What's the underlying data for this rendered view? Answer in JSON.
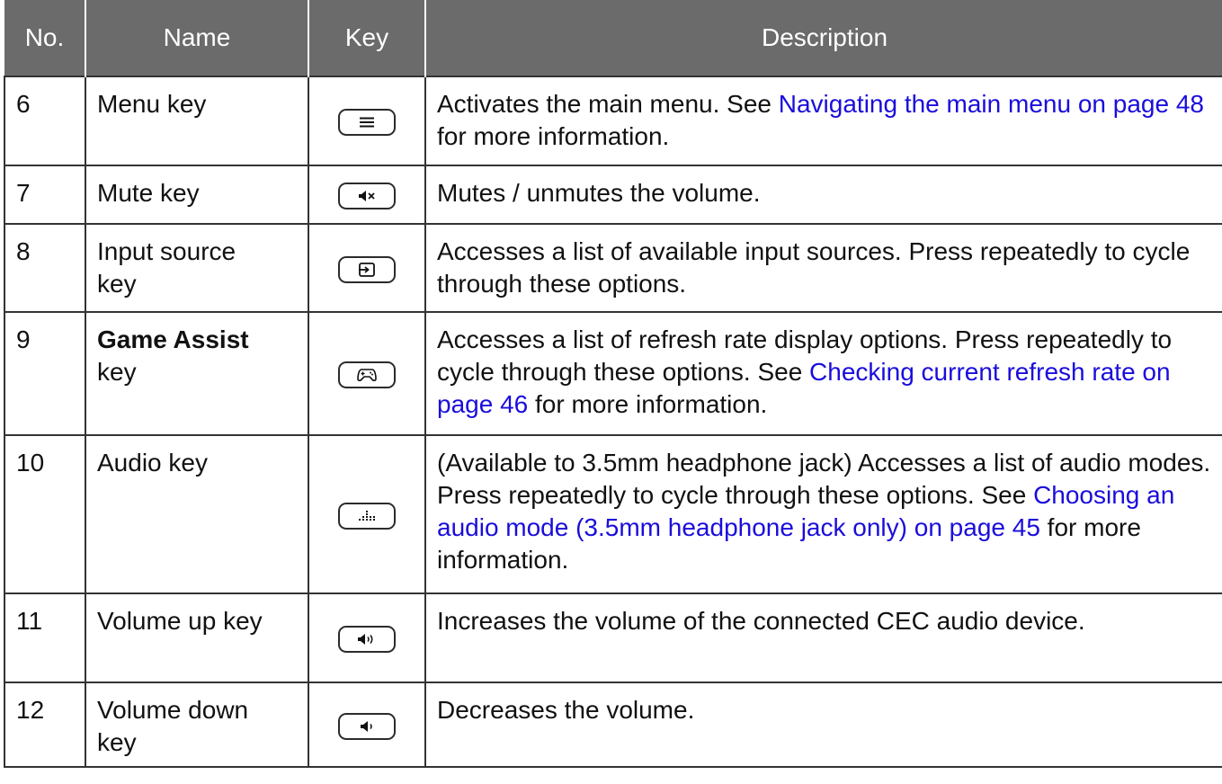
{
  "headers": {
    "no": "No.",
    "name": "Name",
    "key": "Key",
    "description": "Description"
  },
  "rows": [
    {
      "no": "6",
      "name_line1": "Menu key",
      "icon": "menu-icon",
      "desc_text1": "Activates the main menu. See ",
      "desc_link": "Navigating the main menu on page 48",
      "desc_text2": " for more information."
    },
    {
      "no": "7",
      "name_line1": "Mute key",
      "icon": "mute-icon",
      "desc_text1": "Mutes / unmutes the volume."
    },
    {
      "no": "8",
      "name_line1": "Input source",
      "name_line2": "key",
      "icon": "input-source-icon",
      "desc_text1": "Accesses a list of available input sources. Press repeatedly to cycle through these options."
    },
    {
      "no": "9",
      "name_bold": "Game Assist",
      "name_line2": "key",
      "icon": "gamepad-icon",
      "desc_text1": "Accesses a list of refresh rate display options. Press repeatedly to cycle through these options. See ",
      "desc_link": "Checking current refresh rate on page 46",
      "desc_text2": " for more information."
    },
    {
      "no": "10",
      "name_line1": "Audio key",
      "icon": "equalizer-icon",
      "desc_text1": "(Available to 3.5mm headphone jack) Accesses a list of audio modes. Press repeatedly to cycle through these options. See ",
      "desc_link": "Choosing an audio mode (3.5mm headphone jack only) on page 45",
      "desc_text2": " for more information."
    },
    {
      "no": "11",
      "name_line1": "Volume up key",
      "icon": "volume-up-icon",
      "desc_text1": "Increases the volume of the connected CEC audio device."
    },
    {
      "no": "12",
      "name_line1": "Volume down",
      "name_line2": "key",
      "icon": "volume-down-icon",
      "desc_text1": "Decreases the volume."
    }
  ],
  "colors": {
    "header_bg": "#6b6b6b",
    "link": "#1a0ddb",
    "border": "#333333"
  }
}
